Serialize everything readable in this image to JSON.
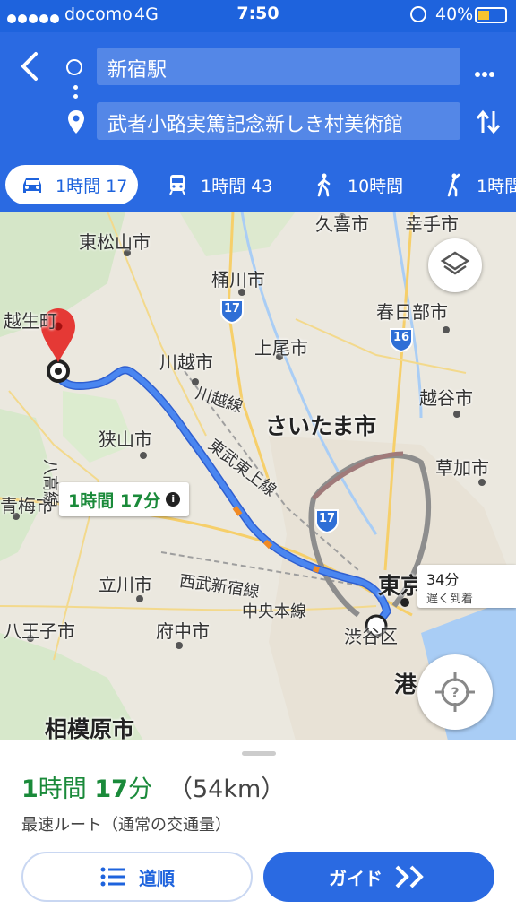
{
  "status_bar": {
    "carrier": "docomo",
    "network": "4G",
    "time": "7:50",
    "battery": "40%"
  },
  "header": {
    "origin": "新宿駅",
    "destination": "武者小路実篤記念新しき村美術館"
  },
  "modes": [
    {
      "icon": "car-icon",
      "label": "1時間 17",
      "active": true
    },
    {
      "icon": "train-icon",
      "label": "1時間 43",
      "active": false
    },
    {
      "icon": "walk-icon",
      "label": "10時間",
      "active": false
    },
    {
      "icon": "ride-icon",
      "label": "1時間",
      "active": false
    }
  ],
  "map": {
    "places": {
      "higashimatsuyama": "東松山市",
      "okegawa": "桶川市",
      "kuki": "久喜市",
      "satte": "幸手市",
      "kasukabe": "春日部市",
      "ageo": "上尾市",
      "kawagoe": "川越市",
      "koshigaya": "越谷市",
      "saitama": "さいたま市",
      "sayama": "狭山市",
      "soka": "草加市",
      "ome": "青梅市",
      "tachikawa": "立川市",
      "fuchu": "府中市",
      "hachioji": "八王子市",
      "sagamihara": "相模原市",
      "tokyo": "東京",
      "shibuya": "渋谷区",
      "minato": "港",
      "ogose": "越生町"
    },
    "rail_labels": {
      "kawagoe_line": "川越線",
      "tobu_tojo": "東武東上線",
      "seibu_shinjuku": "西武新宿線",
      "chuo": "中央本線",
      "hachiko": "八高線"
    },
    "route_shields": {
      "a": "17",
      "b": "16",
      "c": "17"
    },
    "route_callout": "1時間 17分",
    "alt_callout": {
      "time": "34分",
      "note": "遅く到着"
    }
  },
  "sheet": {
    "duration_hours": "1",
    "duration_hours_unit": "時間",
    "duration_minutes": "17",
    "duration_minutes_unit": "分",
    "distance": "（54km）",
    "route_note": "最速ルート（通常の交通量）",
    "steps_label": "道順",
    "guide_label": "ガイド"
  },
  "colors": {
    "header_blue": "#2a6ae2",
    "route_blue": "#4a86f0",
    "green": "#1a8a3a",
    "pin_red": "#e53935"
  }
}
